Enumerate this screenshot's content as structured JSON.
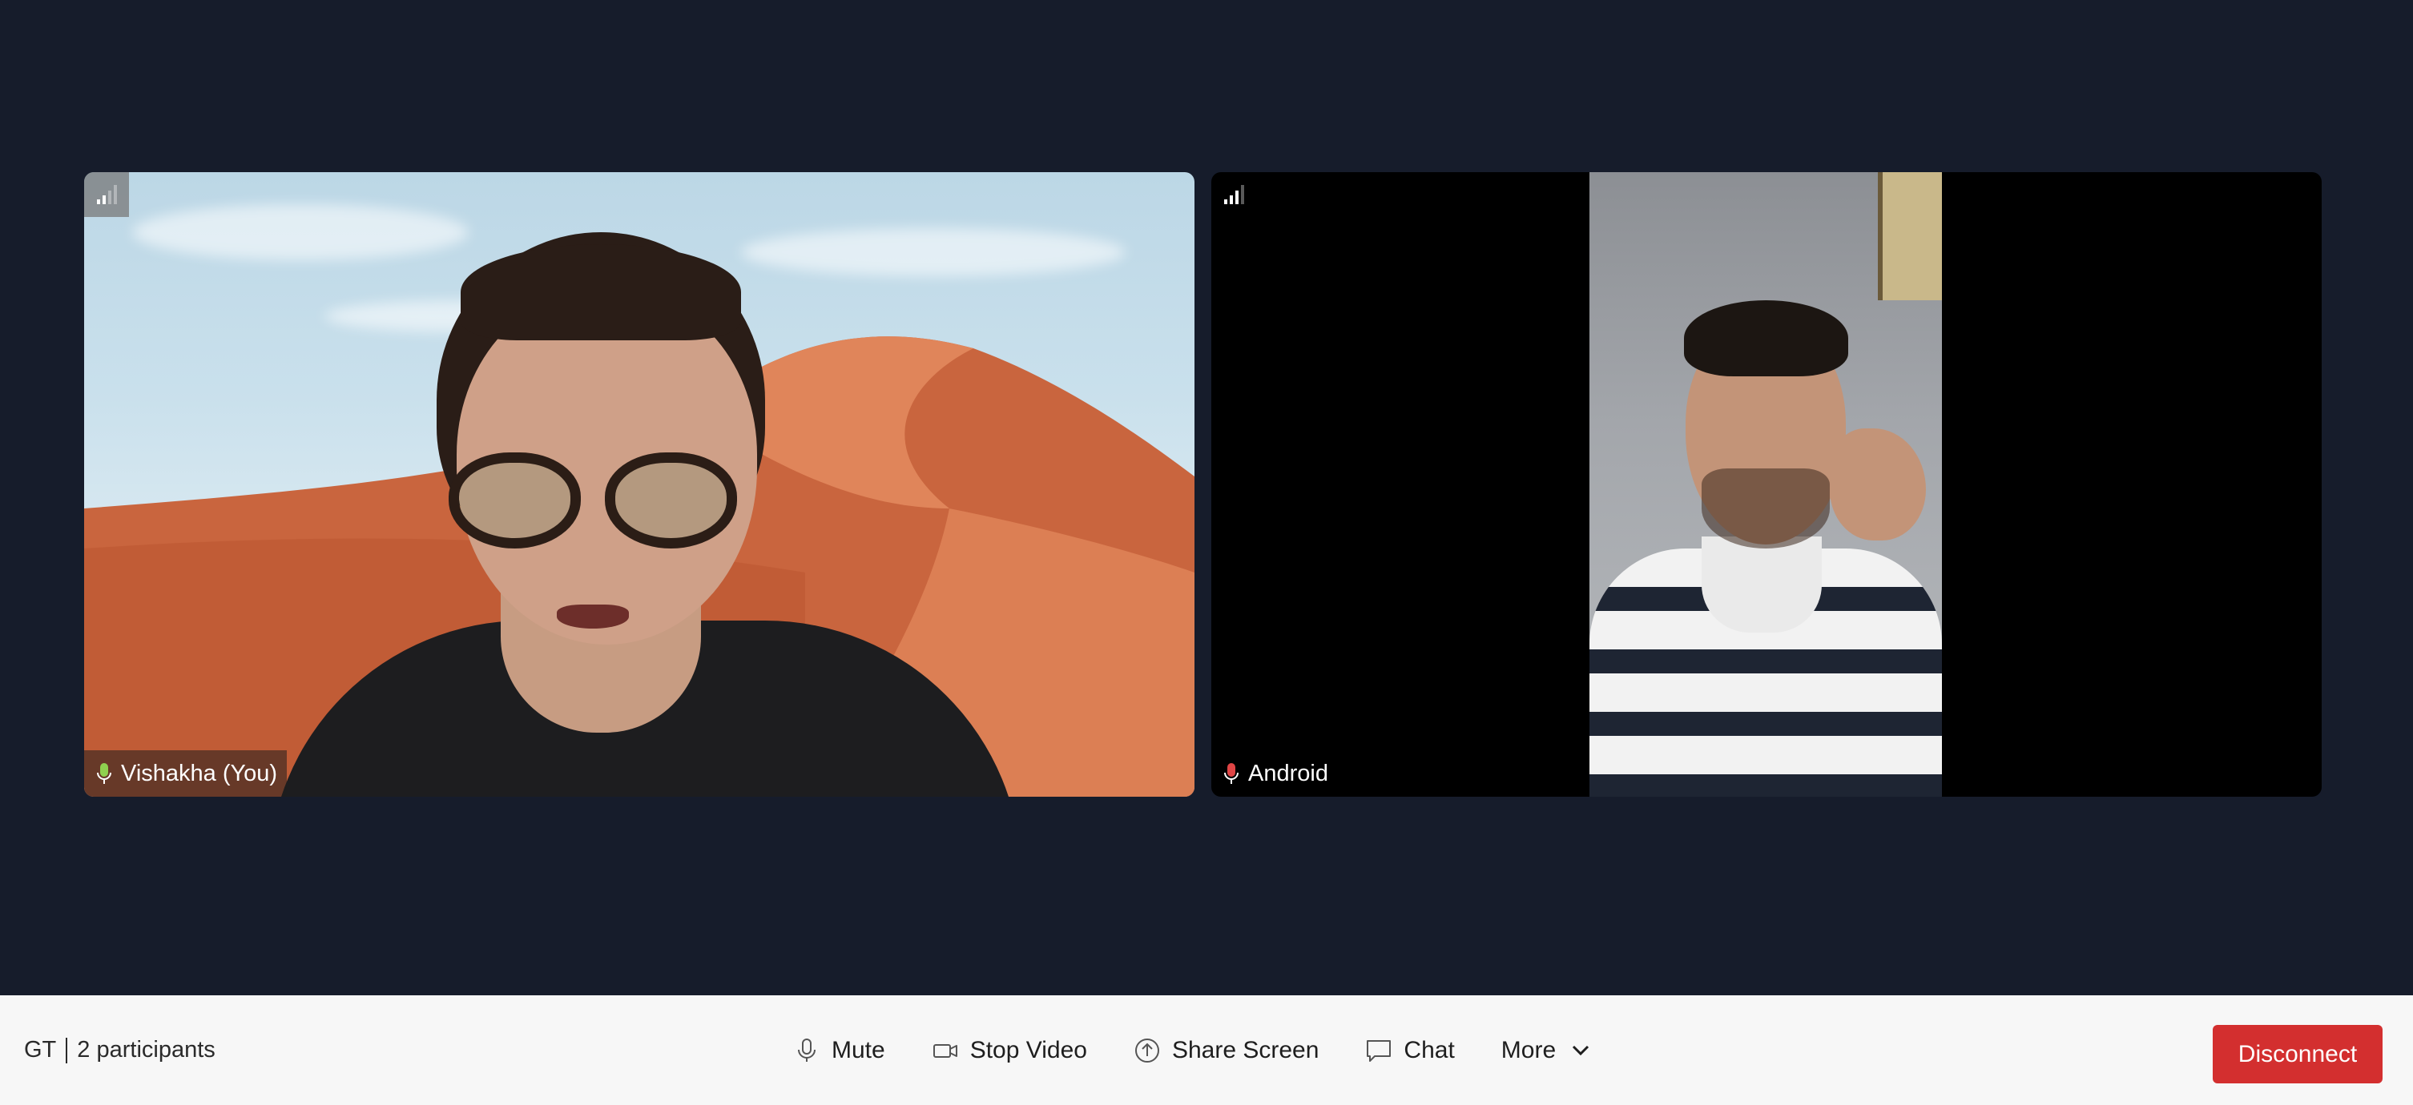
{
  "participants": [
    {
      "name": "Vishakha (You)",
      "signal_icon": "signal-strength-icon",
      "mic_icon": "microphone-icon"
    },
    {
      "name": "Android",
      "signal_icon": "signal-strength-icon",
      "mic_icon": "microphone-icon"
    }
  ],
  "footer": {
    "meeting_code": "GT",
    "participants_count": "2 participants"
  },
  "controls": {
    "mute": "Mute",
    "stop_video": "Stop Video",
    "share_screen": "Share Screen",
    "chat": "Chat",
    "more": "More",
    "disconnect": "Disconnect"
  },
  "colors": {
    "background": "#161c2b",
    "bottom_bar": "#f7f7f7",
    "disconnect": "#d32f2f",
    "mic_active": "#8fd14f"
  }
}
